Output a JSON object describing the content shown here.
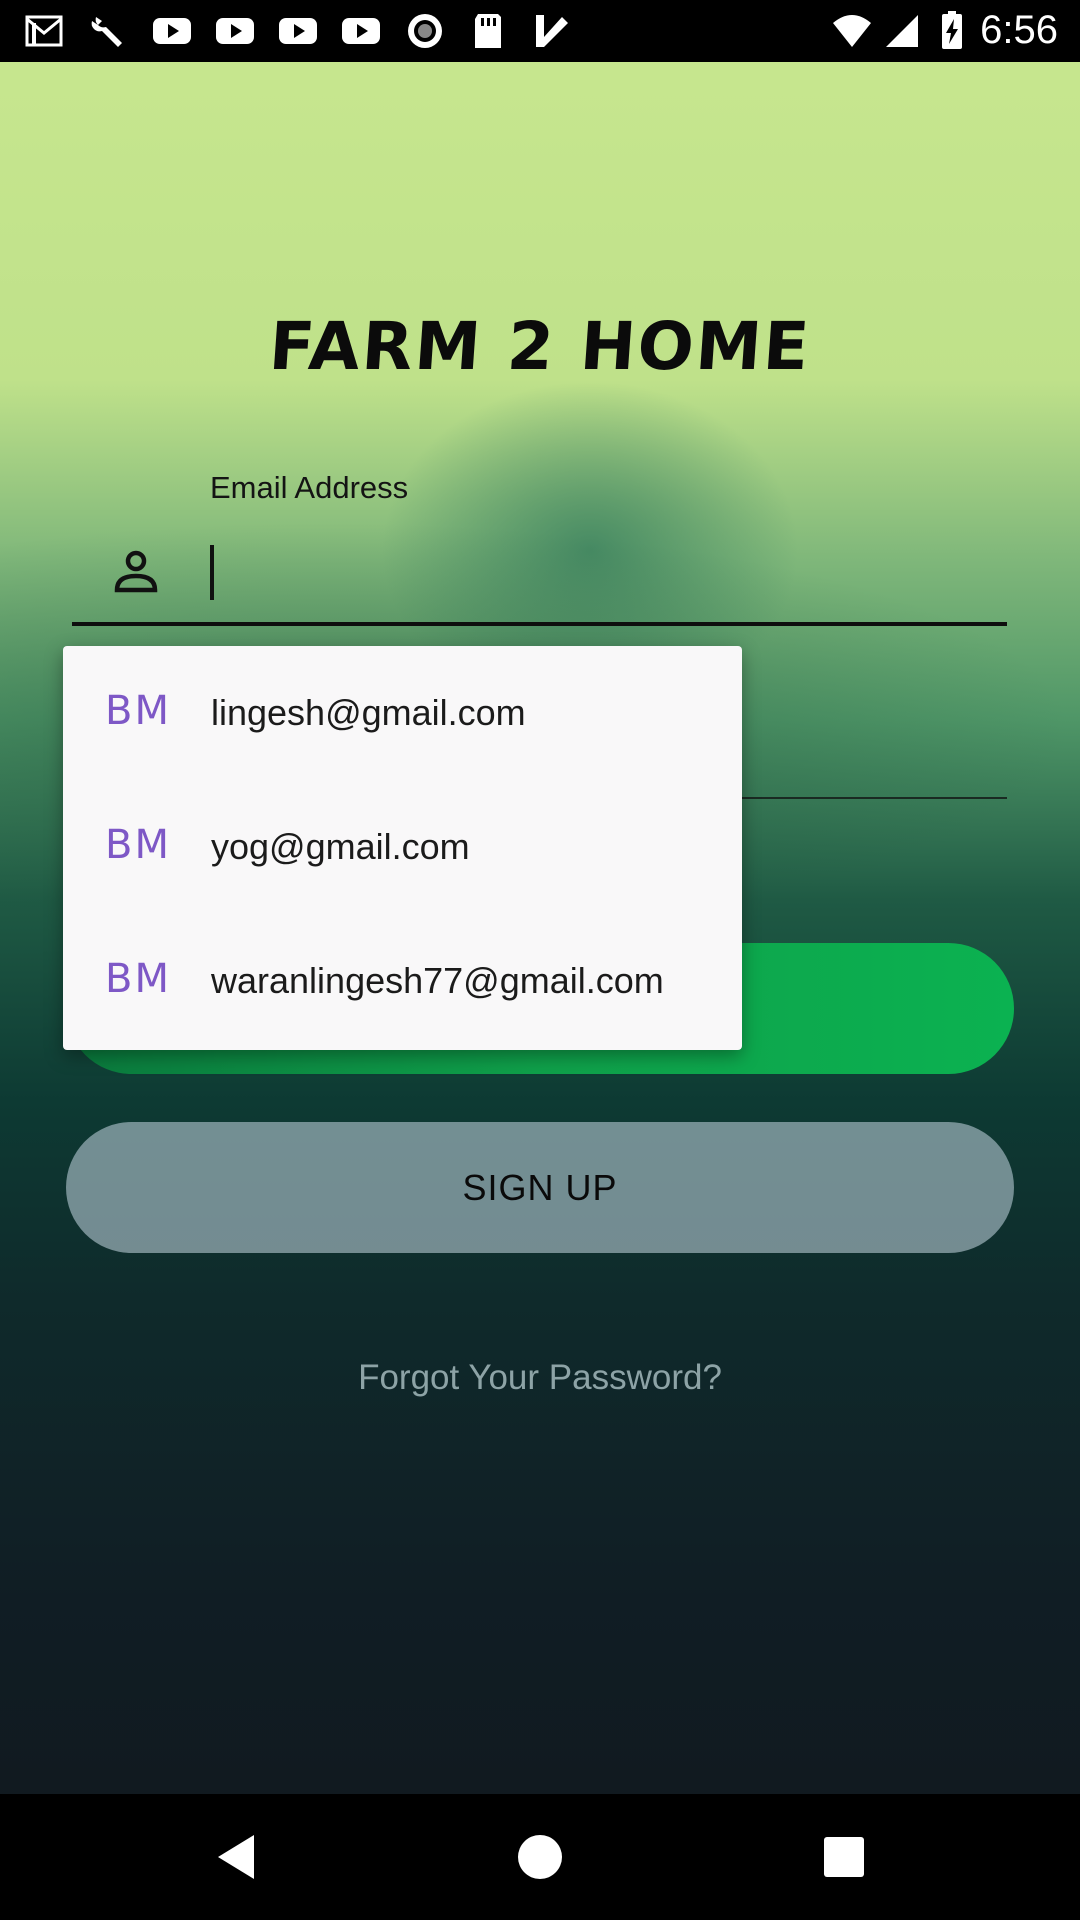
{
  "status_bar": {
    "time": "6:56",
    "left_icons": [
      "gmail-icon",
      "wrench-icon",
      "youtube-icon",
      "youtube-icon",
      "youtube-icon",
      "youtube-icon",
      "record-icon",
      "sd-card-icon",
      "check-icon"
    ],
    "right_icons": [
      "wifi-icon",
      "signal-icon",
      "battery-charging-icon"
    ]
  },
  "app": {
    "title": "FARM 2 HOME"
  },
  "login_form": {
    "email_label": "Email Address",
    "email_value": "",
    "email_icon": "person-icon",
    "login_button_label": "",
    "signup_button_label": "SIGN UP",
    "forgot_password": "Forgot Your Password?"
  },
  "autocomplete": {
    "items": [
      {
        "icon_text": "BM",
        "email": "lingesh@gmail.com"
      },
      {
        "icon_text": "BM",
        "email": "yog@gmail.com"
      },
      {
        "icon_text": "BM",
        "email": "waranlingesh77@gmail.com"
      }
    ]
  },
  "nav_bar": {
    "buttons": [
      "back-icon",
      "home-icon",
      "recents-icon"
    ]
  },
  "colors": {
    "accent_green": "#0fa04a",
    "dropdown_icon": "#7e58c6",
    "forgot_text": "#8da3a6"
  }
}
